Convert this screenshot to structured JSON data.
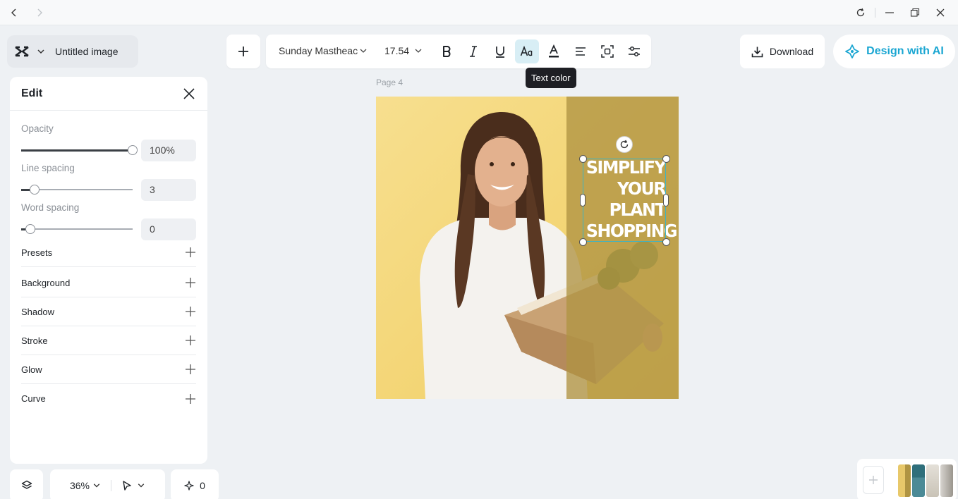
{
  "window": {
    "back_icon": "arrow-left-icon",
    "forward_icon": "arrow-right-icon",
    "controls": [
      "refresh-icon",
      "minimize-icon",
      "restore-icon",
      "close-icon"
    ]
  },
  "project": {
    "name": "Untitled image",
    "logo_icon": "capcut-logo-icon"
  },
  "toolbar": {
    "font": "Sunday Mastheac",
    "size": "17.54",
    "tools": [
      "bold-icon",
      "italic-icon",
      "underline-icon",
      "text-color-icon",
      "highlight-icon",
      "align-icon",
      "effects-icon",
      "adjust-icon"
    ],
    "active_tool": "text-color-icon",
    "tooltip": "Text color"
  },
  "header_actions": {
    "download_label": "Download",
    "ai_label": "Design with AI",
    "ai_color": "#1aa6d2"
  },
  "edit_panel": {
    "title": "Edit",
    "opacity": {
      "label": "Opacity",
      "value": "100%",
      "level": 1.0
    },
    "line_spacing": {
      "label": "Line spacing",
      "value": "3",
      "level": 0.12
    },
    "word_spacing": {
      "label": "Word spacing",
      "value": "0",
      "level": 0.08
    },
    "sections": [
      "Presets",
      "Background",
      "Shadow",
      "Stroke",
      "Glow",
      "Curve"
    ]
  },
  "canvas": {
    "page_label": "Page 4",
    "headline_lines": [
      "SIMPLIFY",
      "YOUR",
      "PLANT",
      "SHOPPING"
    ],
    "panel_color": "#b09442",
    "selection_color": "#3bb4c6"
  },
  "bottom_bar": {
    "zoom": "36%",
    "ai_credits": "0"
  }
}
